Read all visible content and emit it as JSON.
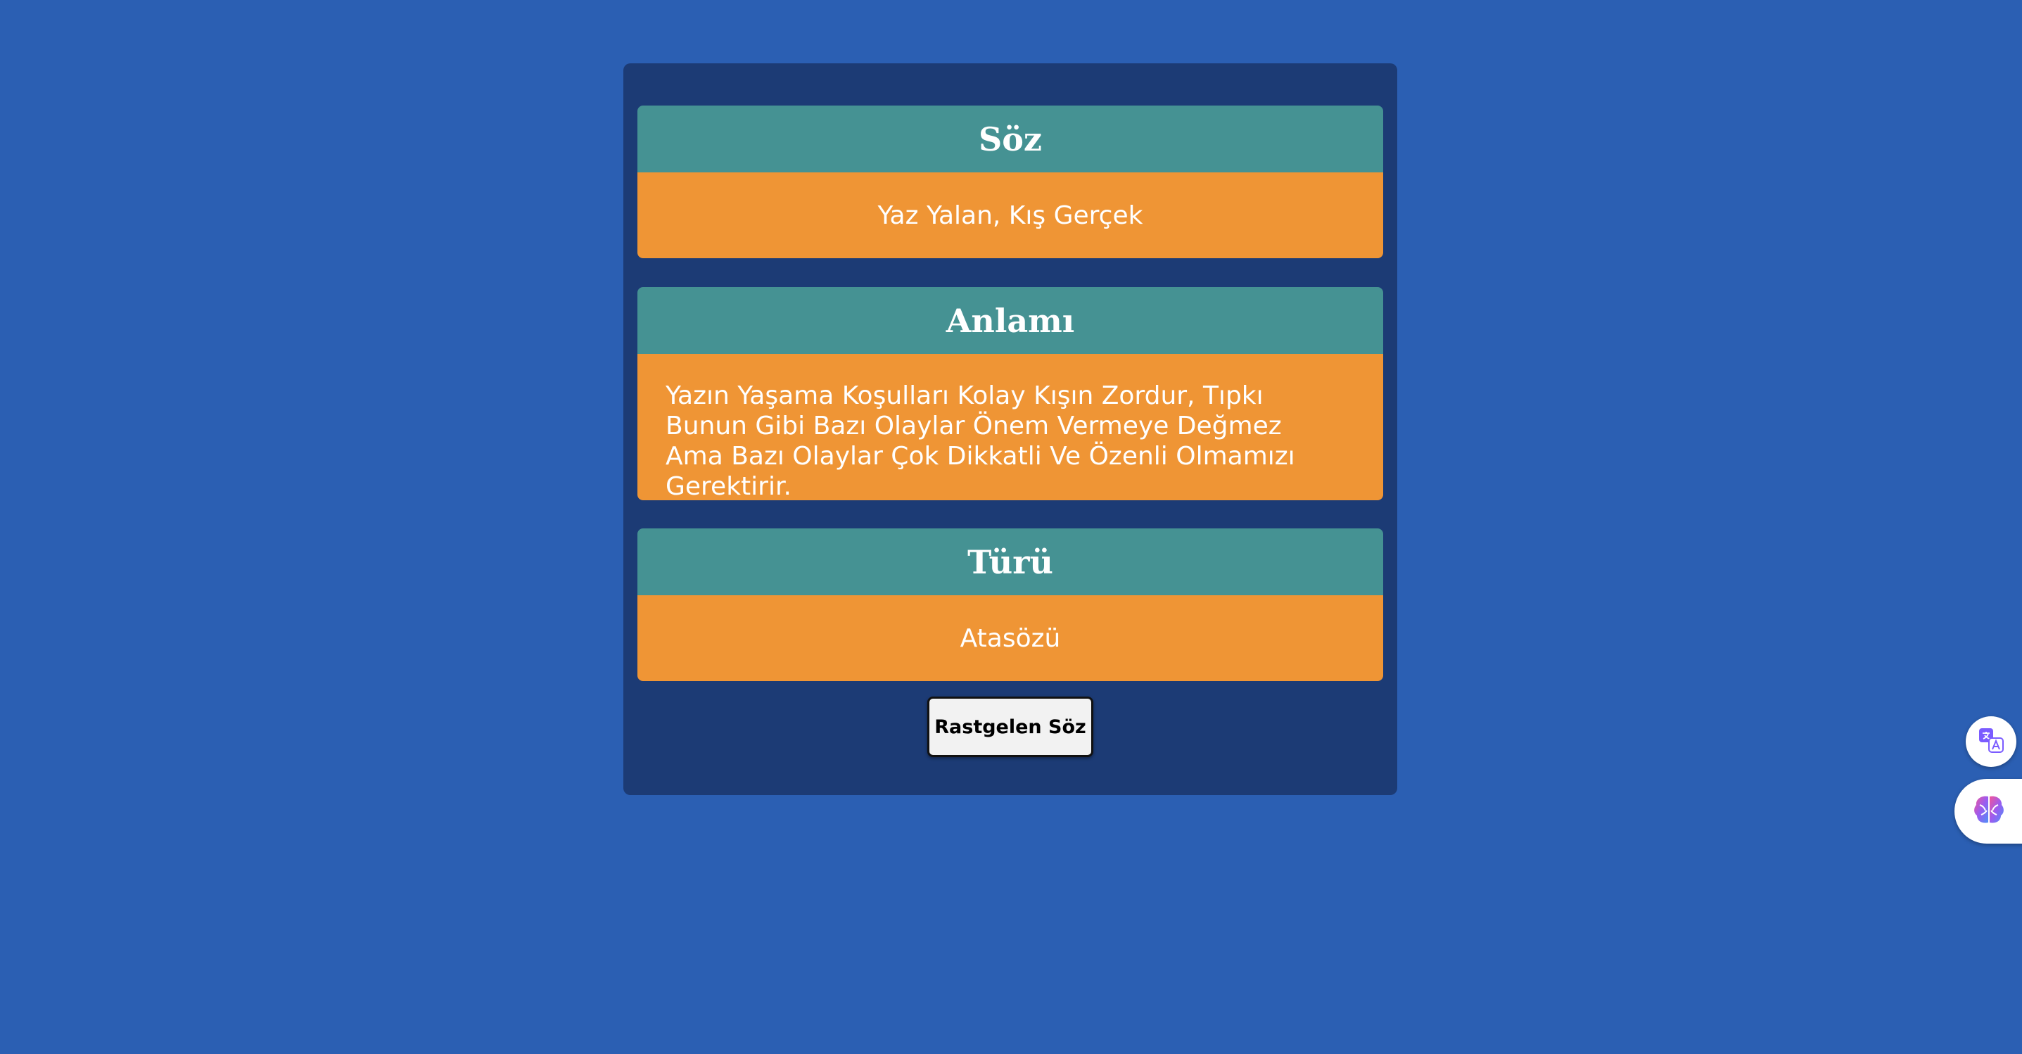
{
  "quote_section": {
    "heading": "Söz",
    "text": "Yaz Yalan, Kış Gerçek"
  },
  "meaning_section": {
    "heading": "Anlamı",
    "text": "Yazın Yaşama Koşulları Kolay Kışın Zordur, Tıpkı Bunun Gibi Bazı Olaylar Önem Vermeye Değmez Ama Bazı Olaylar Çok Dikkatli Ve Özenli Olmamızı Gerektirir."
  },
  "type_section": {
    "heading": "Türü",
    "text": "Atasözü"
  },
  "random_button": {
    "label": "Rastgelen Söz"
  },
  "floating_buttons": {
    "translate_icon": "translate-icon",
    "brain_icon": "brain-icon"
  },
  "colors": {
    "page_background": "#2b5fb3",
    "card_background": "#1c3b75",
    "section_header": "#459293",
    "section_body": "#ef9535"
  }
}
